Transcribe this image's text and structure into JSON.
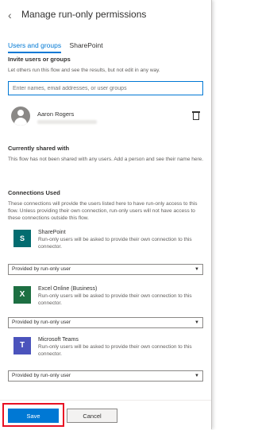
{
  "panel": {
    "title": "Manage run-only permissions",
    "back_icon": "chevron-left-icon"
  },
  "tabs": [
    {
      "label": "Users and groups",
      "active": true
    },
    {
      "label": "SharePoint",
      "active": false
    }
  ],
  "invite": {
    "heading": "Invite users or groups",
    "description": "Let others run this flow and see the results, but not edit in any way.",
    "placeholder": "Enter names, email addresses, or user groups"
  },
  "user": {
    "name": "Aaron Rogers",
    "icon": "person-icon",
    "delete_icon": "trash-icon"
  },
  "shared": {
    "heading": "Currently shared with",
    "description": "This flow has not been shared with any users. Add a person and see their name here."
  },
  "connections": {
    "heading": "Connections Used",
    "description": "These connections will provide the users listed here to have run-only access to this flow. Unless providing their own connection, run-only users will not have access to these connections outside this flow.",
    "items": [
      {
        "name": "SharePoint",
        "logo": "S",
        "description": "Run-only users will be asked to provide their own connection to this connector.",
        "select_value": "Provided by run-only user"
      },
      {
        "name": "Excel Online (Business)",
        "logo": "X",
        "description": "Run-only users will be asked to provide their own connection to this connector.",
        "select_value": "Provided by run-only user"
      },
      {
        "name": "Microsoft Teams",
        "logo": "T",
        "description": "Run-only users will be asked to provide their own connection to this connector.",
        "select_value": "Provided by run-only user"
      }
    ]
  },
  "footer": {
    "save_label": "Save",
    "cancel_label": "Cancel"
  },
  "colors": {
    "accent": "#0078d4",
    "highlight": "#e81123"
  }
}
